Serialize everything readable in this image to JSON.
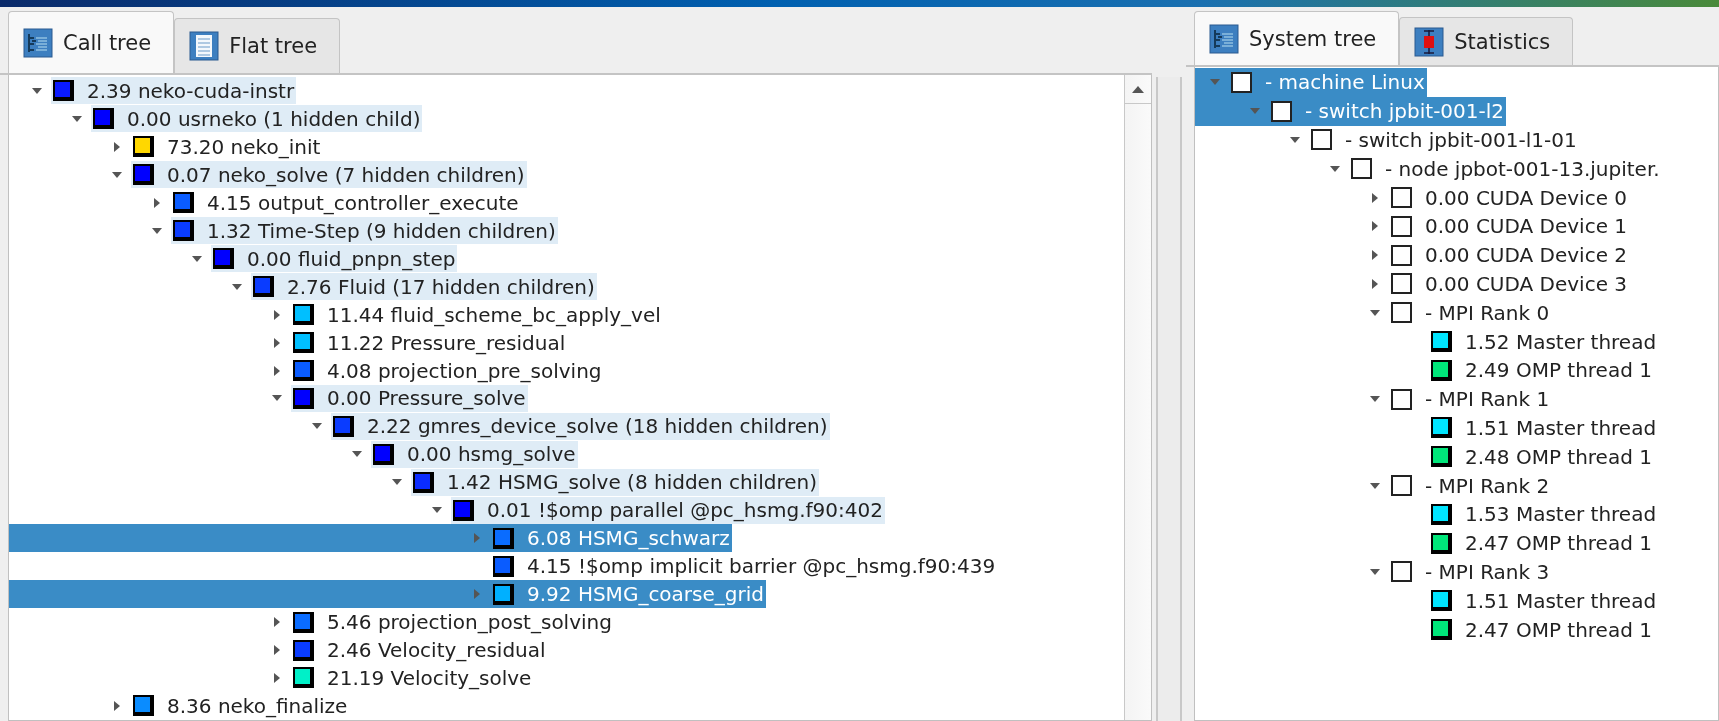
{
  "left_panel": {
    "tabs": [
      {
        "label": "Call tree",
        "kind": "calltree",
        "selected": true
      },
      {
        "label": "Flat tree",
        "kind": "flattree",
        "selected": false
      }
    ],
    "tree": [
      {
        "label": "2.39 neko-cuda-instr",
        "kind": "branch",
        "expanded": true,
        "selected": false,
        "color": "#0a1aff",
        "children": [
          {
            "label": "0.00 usrneko (1 hidden child)",
            "kind": "branch",
            "expanded": true,
            "selected": false,
            "color": "#0000ff",
            "children": [
              {
                "label": "73.20 neko_init",
                "kind": "branch",
                "expanded": false,
                "selected": false,
                "color": "#ffd700"
              },
              {
                "label": "0.07 neko_solve (7 hidden children)",
                "kind": "branch",
                "expanded": true,
                "selected": false,
                "color": "#0000ff",
                "children": [
                  {
                    "label": "4.15 output_controller_execute",
                    "kind": "branch",
                    "expanded": false,
                    "selected": false,
                    "color": "#0a5cff"
                  },
                  {
                    "label": "1.32 Time-Step (9 hidden children)",
                    "kind": "branch",
                    "expanded": true,
                    "selected": false,
                    "color": "#0a3cff",
                    "children": [
                      {
                        "label": "0.00 fluid_pnpn_step",
                        "kind": "branch",
                        "expanded": true,
                        "selected": false,
                        "color": "#0000ff",
                        "children": [
                          {
                            "label": "2.76 Fluid (17 hidden children)",
                            "kind": "branch",
                            "expanded": true,
                            "selected": false,
                            "color": "#0a3cff",
                            "children": [
                              {
                                "label": "11.44 fluid_scheme_bc_apply_vel",
                                "kind": "branch",
                                "expanded": false,
                                "selected": false,
                                "color": "#00bfff"
                              },
                              {
                                "label": "11.22 Pressure_residual",
                                "kind": "branch",
                                "expanded": false,
                                "selected": false,
                                "color": "#00bfff"
                              },
                              {
                                "label": "4.08 projection_pre_solving",
                                "kind": "branch",
                                "expanded": false,
                                "selected": false,
                                "color": "#0a5cff"
                              },
                              {
                                "label": "0.00 Pressure_solve",
                                "kind": "branch",
                                "expanded": true,
                                "selected": false,
                                "color": "#0000ff",
                                "children": [
                                  {
                                    "label": "2.22 gmres_device_solve (18 hidden children)",
                                    "kind": "branch",
                                    "expanded": true,
                                    "selected": false,
                                    "color": "#0a3cff",
                                    "children": [
                                      {
                                        "label": "0.00 hsmg_solve",
                                        "kind": "branch",
                                        "expanded": true,
                                        "selected": false,
                                        "color": "#0000ff",
                                        "children": [
                                          {
                                            "label": "1.42 HSMG_solve (8 hidden children)",
                                            "kind": "branch",
                                            "expanded": true,
                                            "selected": false,
                                            "color": "#0a2cff",
                                            "children": [
                                              {
                                                "label": "0.01 !$omp parallel @pc_hsmg.f90:402",
                                                "kind": "branch",
                                                "expanded": true,
                                                "selected": false,
                                                "color": "#0000ff",
                                                "children": [
                                                  {
                                                    "label": "6.08 HSMG_schwarz",
                                                    "kind": "branch",
                                                    "expanded": false,
                                                    "selected": true,
                                                    "color": "#0a6cff"
                                                  },
                                                  {
                                                    "label": "4.15 !$omp implicit barrier @pc_hsmg.f90:439",
                                                    "kind": "leaf",
                                                    "selected": false,
                                                    "color": "#0a5cff"
                                                  },
                                                  {
                                                    "label": "9.92 HSMG_coarse_grid",
                                                    "kind": "branch",
                                                    "expanded": false,
                                                    "selected": true,
                                                    "color": "#00b0ff"
                                                  }
                                                ]
                                              }
                                            ]
                                          }
                                        ]
                                      }
                                    ]
                                  }
                                ]
                              },
                              {
                                "label": "5.46 projection_post_solving",
                                "kind": "branch",
                                "expanded": false,
                                "selected": false,
                                "color": "#0a6cff"
                              },
                              {
                                "label": "2.46 Velocity_residual",
                                "kind": "branch",
                                "expanded": false,
                                "selected": false,
                                "color": "#0a3cff"
                              },
                              {
                                "label": "21.19 Velocity_solve",
                                "kind": "branch",
                                "expanded": false,
                                "selected": false,
                                "color": "#00f0c8"
                              }
                            ]
                          }
                        ]
                      }
                    ]
                  }
                ]
              },
              {
                "label": "8.36 neko_finalize",
                "kind": "branch",
                "expanded": false,
                "selected": false,
                "color": "#0a8cff"
              }
            ]
          }
        ]
      }
    ]
  },
  "right_panel": {
    "tabs": [
      {
        "label": "System tree",
        "kind": "systemtree",
        "selected": true
      },
      {
        "label": "Statistics",
        "kind": "statistics",
        "selected": false
      }
    ],
    "tree": [
      {
        "label": "- machine Linux",
        "kind": "checkbox",
        "checked": false,
        "expanded": true,
        "selected": true,
        "children": [
          {
            "label": "- switch jpbit-001-l2",
            "kind": "checkbox",
            "checked": false,
            "expanded": true,
            "selected": true,
            "children": [
              {
                "label": "- switch jpbit-001-l1-01",
                "kind": "checkbox",
                "checked": false,
                "expanded": true,
                "selected": false,
                "children": [
                  {
                    "label": "- node jpbot-001-13.jupiter.",
                    "kind": "checkbox",
                    "checked": false,
                    "expanded": true,
                    "selected": false,
                    "children": [
                      {
                        "label": "0.00 CUDA Device 0",
                        "kind": "checkbox",
                        "checked": false,
                        "expanded": false,
                        "selected": false
                      },
                      {
                        "label": "0.00 CUDA Device 1",
                        "kind": "checkbox",
                        "checked": false,
                        "expanded": false,
                        "selected": false
                      },
                      {
                        "label": "0.00 CUDA Device 2",
                        "kind": "checkbox",
                        "checked": false,
                        "expanded": false,
                        "selected": false
                      },
                      {
                        "label": "0.00 CUDA Device 3",
                        "kind": "checkbox",
                        "checked": false,
                        "expanded": false,
                        "selected": false
                      },
                      {
                        "label": "- MPI Rank 0",
                        "kind": "checkbox",
                        "checked": false,
                        "expanded": true,
                        "selected": false,
                        "children": [
                          {
                            "label": "1.52 Master thread",
                            "kind": "swatch",
                            "selected": false,
                            "color": "#00e5ff"
                          },
                          {
                            "label": "2.49 OMP thread 1",
                            "kind": "swatch",
                            "selected": false,
                            "color": "#00e67a"
                          }
                        ]
                      },
                      {
                        "label": "- MPI Rank 1",
                        "kind": "checkbox",
                        "checked": false,
                        "expanded": true,
                        "selected": false,
                        "children": [
                          {
                            "label": "1.51 Master thread",
                            "kind": "swatch",
                            "selected": false,
                            "color": "#00e5ff"
                          },
                          {
                            "label": "2.48 OMP thread 1",
                            "kind": "swatch",
                            "selected": false,
                            "color": "#00e67a"
                          }
                        ]
                      },
                      {
                        "label": "- MPI Rank 2",
                        "kind": "checkbox",
                        "checked": false,
                        "expanded": true,
                        "selected": false,
                        "children": [
                          {
                            "label": "1.53 Master thread",
                            "kind": "swatch",
                            "selected": false,
                            "color": "#00e5ff"
                          },
                          {
                            "label": "2.47 OMP thread 1",
                            "kind": "swatch",
                            "selected": false,
                            "color": "#00e67a"
                          }
                        ]
                      },
                      {
                        "label": "- MPI Rank 3",
                        "kind": "checkbox",
                        "checked": false,
                        "expanded": true,
                        "selected": false,
                        "children": [
                          {
                            "label": "1.51 Master thread",
                            "kind": "swatch",
                            "selected": false,
                            "color": "#00e5ff"
                          },
                          {
                            "label": "2.47 OMP thread 1",
                            "kind": "swatch",
                            "selected": false,
                            "color": "#00e67a"
                          }
                        ]
                      }
                    ]
                  }
                ]
              }
            ]
          }
        ]
      }
    ]
  }
}
